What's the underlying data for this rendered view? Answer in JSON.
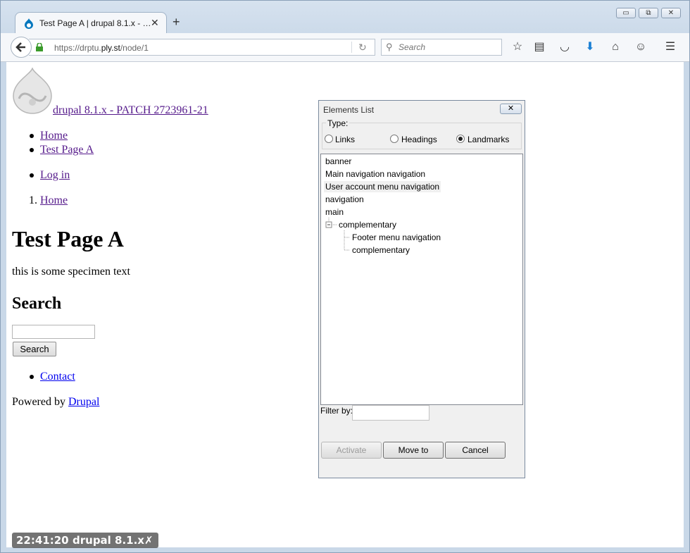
{
  "browser": {
    "tab_title": "Test Page A | drupal 8.1.x - …",
    "tab_close": "✕",
    "new_tab": "+",
    "url_host_prefix": "https://drptu.",
    "url_host_main": "ply.st",
    "url_path": "/node/1",
    "search_placeholder": "Search",
    "win_minimize": "▭",
    "win_restore": "⧉",
    "win_close": "✕"
  },
  "site": {
    "name": " drupal 8.1.x - PATCH 2723961-21",
    "main_nav": [
      "Home",
      "Test Page A"
    ],
    "user_nav": [
      "Log in"
    ],
    "breadcrumb_num": "1.",
    "breadcrumb": "Home",
    "heading": "Test Page A",
    "body": "this is some specimen text",
    "search_heading": "Search",
    "search_button": "Search",
    "footer_link": "Contact",
    "powered_prefix": "Powered by ",
    "powered_link": "Drupal"
  },
  "dialog": {
    "title": "Elements List",
    "close": "✕",
    "type_label": "Type:",
    "radios": [
      "Links",
      "Headings",
      "Landmarks"
    ],
    "selected_radio": "Landmarks",
    "tree": [
      "banner",
      "Main navigation navigation",
      "User account menu navigation",
      "navigation",
      "main",
      "complementary",
      "Footer menu navigation",
      "complementary"
    ],
    "filter_label": "Filter by:",
    "buttons": [
      "Activate",
      "Move to",
      "Cancel"
    ]
  },
  "status": {
    "time": "22:41:20",
    "label": "drupal 8.1.x",
    "close": "✗"
  },
  "colors": {
    "link_visited": "#551a8b",
    "link": "#0000ee",
    "download_arrow": "#1a7fd4"
  }
}
